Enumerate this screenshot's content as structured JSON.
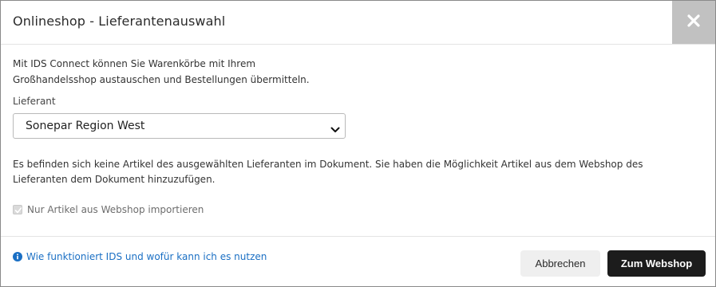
{
  "dialog": {
    "title": "Onlineshop - Lieferantenauswahl",
    "close_icon": "close-icon"
  },
  "intro": {
    "line1": "Mit IDS Connect können Sie Warenkörbe mit Ihrem",
    "line2": "Großhandelsshop austauschen und Bestellungen übermitteln."
  },
  "supplier": {
    "label": "Lieferant",
    "selected": "Sonepar Region West",
    "chevron_icon": "chevron-down-icon"
  },
  "info": {
    "line1": "Es befinden sich keine Artikel des ausgewählten Lieferanten im Dokument. Sie haben die Möglichkeit Artikel aus dem Webshop des",
    "line2": "Lieferanten dem Dokument hinzuzufügen."
  },
  "import_checkbox": {
    "label": "Nur Artikel aus Webshop importieren",
    "checked": true,
    "disabled": true
  },
  "footer": {
    "help_link": "Wie funktioniert IDS und wofür kann ich es nutzen",
    "help_icon": "info-icon",
    "cancel_label": "Abbrechen",
    "primary_label": "Zum Webshop"
  },
  "colors": {
    "link": "#1a6fc4",
    "primary_button": "#1c1c1c",
    "close_button": "#c1c1c1"
  }
}
